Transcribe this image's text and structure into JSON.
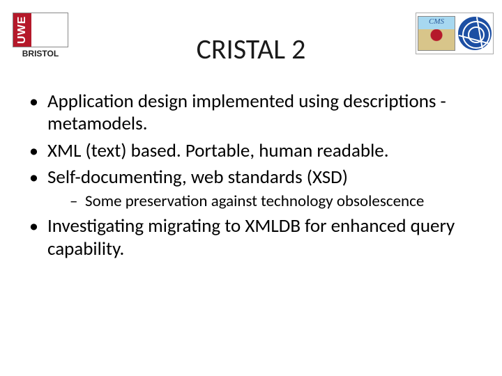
{
  "logos": {
    "uwe_vertical": "UWE",
    "uwe_sub": "BRISTOL",
    "cms_label": "CMS"
  },
  "title": "CRISTAL 2",
  "bullets": {
    "b1": "Application design implemented using descriptions - metamodels.",
    "b2": "XML (text) based. Portable, human readable.",
    "b3": "Self-documenting, web standards (XSD)",
    "b3_sub1": "Some preservation against technology obsolescence",
    "b4": "Investigating migrating to XMLDB for enhanced query capability."
  }
}
